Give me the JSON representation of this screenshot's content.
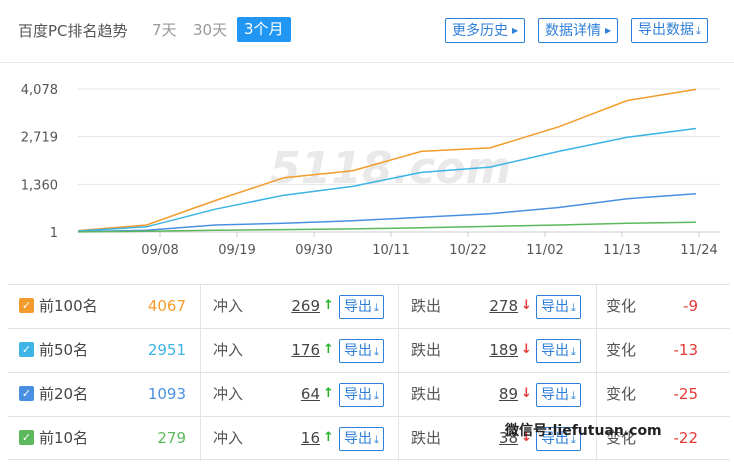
{
  "header": {
    "title": "百度PC排名趋势",
    "ranges": [
      "7天",
      "30天",
      "3个月"
    ],
    "active_range": "3个月",
    "buttons": {
      "history": "更多历史",
      "details": "数据详情",
      "export": "导出数据"
    }
  },
  "watermark": {
    "logo": "5118.com",
    "text": "微信号:liefutuan.com"
  },
  "colors": {
    "top100": "#f39c2b",
    "top50": "#3cb4e5",
    "top20": "#4a90e2",
    "top10": "#5cb85c",
    "accent": "#2196f3"
  },
  "chart_data": {
    "type": "line",
    "x": [
      "09/08",
      "09/19",
      "09/30",
      "10/11",
      "10/22",
      "11/02",
      "11/13",
      "11/24"
    ],
    "yticks": [
      1,
      1360,
      2719,
      4078
    ],
    "ytick_labels": [
      "1",
      "1,360",
      "2,719",
      "4,078"
    ],
    "ylim": [
      1,
      4078
    ],
    "grid": true,
    "series": [
      {
        "name": "前100名",
        "color": "#f39c2b",
        "values": [
          40,
          200,
          900,
          1550,
          1750,
          2300,
          2400,
          3000,
          3750,
          4067
        ]
      },
      {
        "name": "前50名",
        "color": "#3cb4e5",
        "values": [
          30,
          150,
          650,
          1050,
          1300,
          1700,
          1850,
          2300,
          2700,
          2951
        ]
      },
      {
        "name": "前20名",
        "color": "#4a90e2",
        "values": [
          10,
          50,
          200,
          250,
          320,
          420,
          520,
          700,
          950,
          1093
        ]
      },
      {
        "name": "前10名",
        "color": "#5cb85c",
        "values": [
          5,
          20,
          50,
          70,
          90,
          120,
          160,
          200,
          250,
          279
        ]
      }
    ]
  },
  "rows": [
    {
      "label": "前100名",
      "count": "4067",
      "in_label": "冲入",
      "in": "269",
      "out_label": "跌出",
      "out": "278",
      "export": "导出",
      "change_label": "变化",
      "change": "-9"
    },
    {
      "label": "前50名",
      "count": "2951",
      "in_label": "冲入",
      "in": "176",
      "out_label": "跌出",
      "out": "189",
      "export": "导出",
      "change_label": "变化",
      "change": "-13"
    },
    {
      "label": "前20名",
      "count": "1093",
      "in_label": "冲入",
      "in": "64",
      "out_label": "跌出",
      "out": "89",
      "export": "导出",
      "change_label": "变化",
      "change": "-25"
    },
    {
      "label": "前10名",
      "count": "279",
      "in_label": "冲入",
      "in": "16",
      "out_label": "跌出",
      "out": "38",
      "export": "导出",
      "change_label": "变化",
      "change": "-22"
    }
  ]
}
